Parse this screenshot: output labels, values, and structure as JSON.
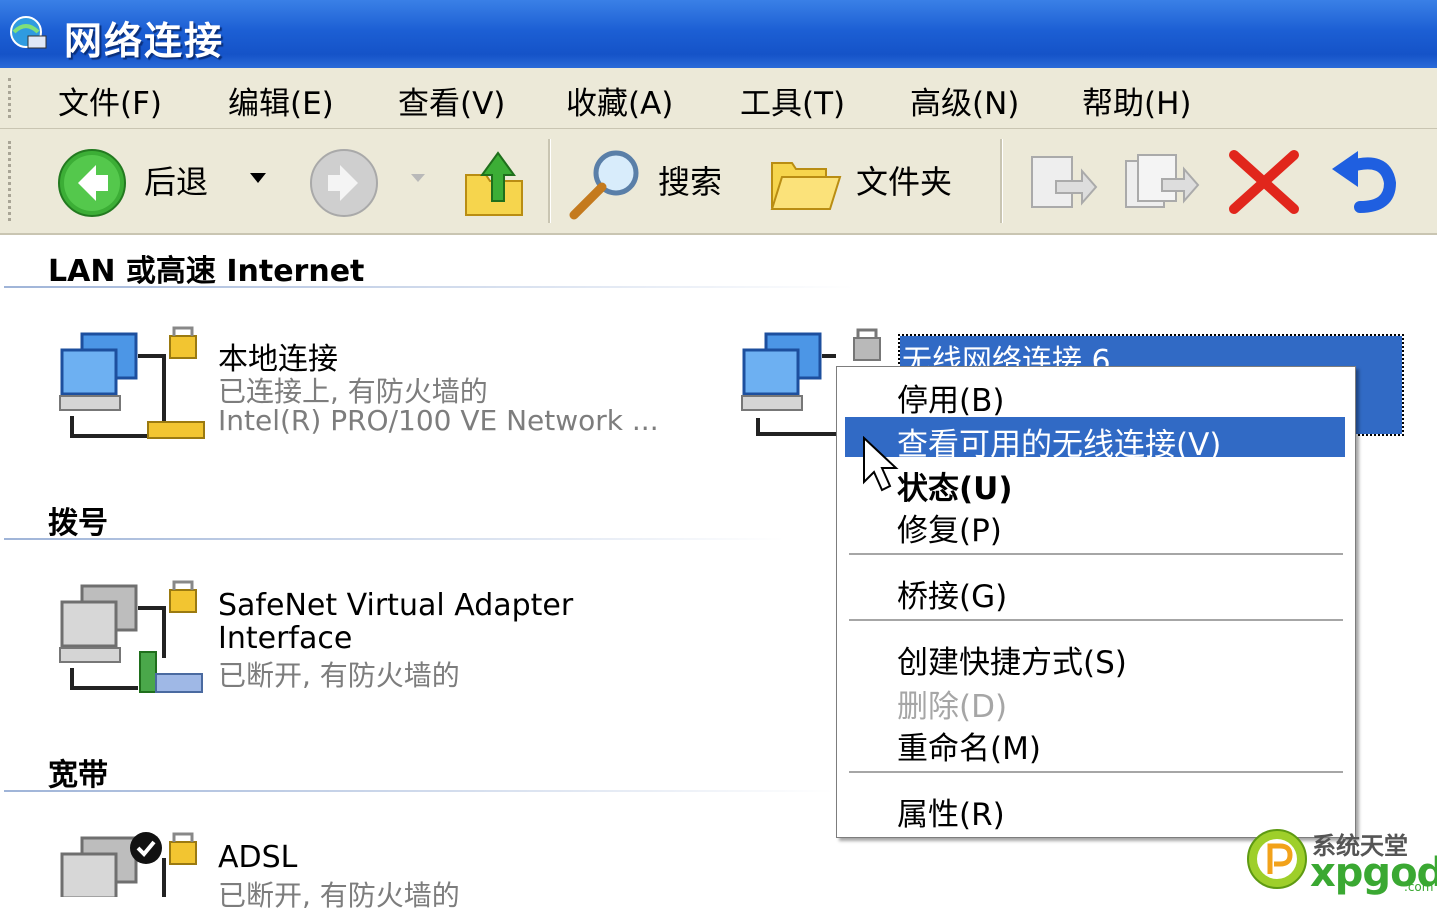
{
  "window": {
    "title": "网络连接"
  },
  "menubar": {
    "items": [
      "文件(F)",
      "编辑(E)",
      "查看(V)",
      "收藏(A)",
      "工具(T)",
      "高级(N)",
      "帮助(H)"
    ]
  },
  "toolbar": {
    "back_label": "后退",
    "search_label": "搜索",
    "folders_label": "文件夹"
  },
  "groups": {
    "lan": {
      "title": "LAN 或高速 Internet"
    },
    "dialup": {
      "title": "拨号"
    },
    "broadband": {
      "title": "宽带"
    }
  },
  "connections": {
    "local": {
      "name": "本地连接",
      "status": "已连接上, 有防火墙的",
      "device": "Intel(R) PRO/100 VE Network ..."
    },
    "wireless": {
      "name": "无线网络连接 6"
    },
    "safenet": {
      "name_line1": "SafeNet Virtual Adapter",
      "name_line2": "Interface",
      "status": "已断开, 有防火墙的"
    },
    "adsl": {
      "name": "ADSL",
      "status": "已断开, 有防火墙的"
    }
  },
  "context_menu": {
    "disable": "停用(B)",
    "view_wireless": "查看可用的无线连接(V)",
    "status": "状态(U)",
    "repair": "修复(P)",
    "bridge": "桥接(G)",
    "shortcut": "创建快捷方式(S)",
    "delete": "删除(D)",
    "rename": "重命名(M)",
    "properties": "属性(R)"
  },
  "watermark": {
    "top": "系统天堂",
    "bottom": "xpgod",
    "suffix": ".com"
  },
  "colors": {
    "title_blue": "#1c5fd4",
    "selection": "#316ac5",
    "chrome": "#ece9d8"
  }
}
